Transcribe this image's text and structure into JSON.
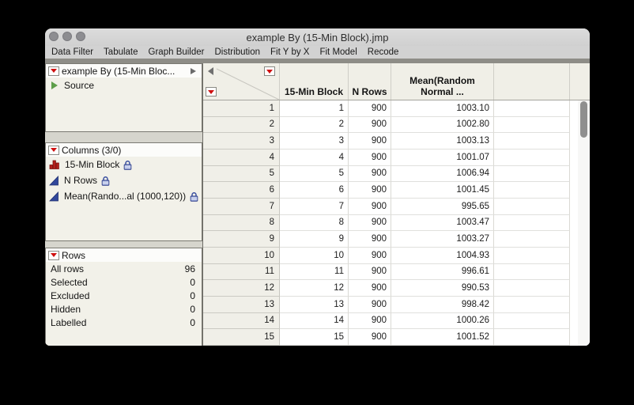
{
  "window": {
    "title": "example By (15-Min Block).jmp"
  },
  "menu": {
    "items": [
      "Data Filter",
      "Tabulate",
      "Graph Builder",
      "Distribution",
      "Fit Y by X",
      "Fit Model",
      "Recode"
    ]
  },
  "sidebar": {
    "table_panel": {
      "title": "example By (15-Min Bloc...",
      "source_label": "Source"
    },
    "columns_panel": {
      "title": "Columns (3/0)",
      "items": [
        {
          "label": "15-Min Block",
          "icon": "histogram-icon",
          "locked": true
        },
        {
          "label": "N Rows",
          "icon": "continuous-icon",
          "locked": true
        },
        {
          "label": "Mean(Rando...al (1000,120))",
          "icon": "continuous-icon",
          "locked": true
        }
      ]
    },
    "rows_panel": {
      "title": "Rows",
      "stats": [
        {
          "label": "All rows",
          "value": "96"
        },
        {
          "label": "Selected",
          "value": "0"
        },
        {
          "label": "Excluded",
          "value": "0"
        },
        {
          "label": "Hidden",
          "value": "0"
        },
        {
          "label": "Labelled",
          "value": "0"
        }
      ]
    }
  },
  "table": {
    "header": {
      "col1": "15-Min Block",
      "col2": "N Rows",
      "col3_line1": "Mean(Random",
      "col3_line2": "Normal ..."
    },
    "rows": [
      [
        "1",
        "1",
        "900",
        "1003.10"
      ],
      [
        "2",
        "2",
        "900",
        "1002.80"
      ],
      [
        "3",
        "3",
        "900",
        "1003.13"
      ],
      [
        "4",
        "4",
        "900",
        "1001.07"
      ],
      [
        "5",
        "5",
        "900",
        "1006.94"
      ],
      [
        "6",
        "6",
        "900",
        "1001.45"
      ],
      [
        "7",
        "7",
        "900",
        "995.65"
      ],
      [
        "8",
        "8",
        "900",
        "1003.47"
      ],
      [
        "9",
        "9",
        "900",
        "1003.27"
      ],
      [
        "10",
        "10",
        "900",
        "1004.93"
      ],
      [
        "11",
        "11",
        "900",
        "996.61"
      ],
      [
        "12",
        "12",
        "900",
        "990.53"
      ],
      [
        "13",
        "13",
        "900",
        "998.42"
      ],
      [
        "14",
        "14",
        "900",
        "1000.26"
      ],
      [
        "15",
        "15",
        "900",
        "1001.52"
      ]
    ]
  },
  "colors": {
    "red_triangle": "#cf1010",
    "histogram_red": "#b3201c",
    "continuous_blue": "#31479b",
    "lock_blue": "#3a50a0",
    "source_green": "#5d9e4a"
  }
}
